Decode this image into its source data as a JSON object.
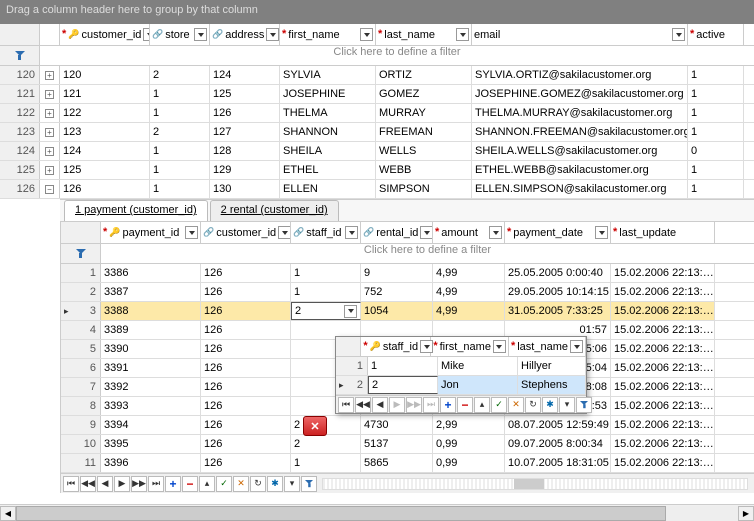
{
  "group_hint": "Drag a column header here to group by that column",
  "filter_hint": "Click here to define a filter",
  "main_columns": {
    "customer_id": "customer_id",
    "store": "store",
    "address": "address",
    "first_name": "first_name",
    "last_name": "last_name",
    "email": "email",
    "active": "active"
  },
  "main_rows": [
    {
      "rn": "120",
      "cid": "120",
      "store": "2",
      "addr": "124",
      "fn": "SYLVIA",
      "ln": "ORTIZ",
      "email": "SYLVIA.ORTIZ@sakilacustomer.org",
      "act": "1",
      "exp": "plus"
    },
    {
      "rn": "121",
      "cid": "121",
      "store": "1",
      "addr": "125",
      "fn": "JOSEPHINE",
      "ln": "GOMEZ",
      "email": "JOSEPHINE.GOMEZ@sakilacustomer.org",
      "act": "1",
      "exp": "plus"
    },
    {
      "rn": "122",
      "cid": "122",
      "store": "1",
      "addr": "126",
      "fn": "THELMA",
      "ln": "MURRAY",
      "email": "THELMA.MURRAY@sakilacustomer.org",
      "act": "1",
      "exp": "plus"
    },
    {
      "rn": "123",
      "cid": "123",
      "store": "2",
      "addr": "127",
      "fn": "SHANNON",
      "ln": "FREEMAN",
      "email": "SHANNON.FREEMAN@sakilacustomer.org",
      "act": "1",
      "exp": "plus"
    },
    {
      "rn": "124",
      "cid": "124",
      "store": "1",
      "addr": "128",
      "fn": "SHEILA",
      "ln": "WELLS",
      "email": "SHEILA.WELLS@sakilacustomer.org",
      "act": "0",
      "exp": "plus"
    },
    {
      "rn": "125",
      "cid": "125",
      "store": "1",
      "addr": "129",
      "fn": "ETHEL",
      "ln": "WEBB",
      "email": "ETHEL.WEBB@sakilacustomer.org",
      "act": "1",
      "exp": "plus"
    },
    {
      "rn": "126",
      "cid": "126",
      "store": "1",
      "addr": "130",
      "fn": "ELLEN",
      "ln": "SIMPSON",
      "email": "ELLEN.SIMPSON@sakilacustomer.org",
      "act": "1",
      "exp": "minus"
    }
  ],
  "tabs": {
    "payment": "1 payment (customer_id)",
    "rental": "2 rental (customer_id)"
  },
  "sub_columns": {
    "payment_id": "payment_id",
    "customer_id": "customer_id",
    "staff_id": "staff_id",
    "rental_id": "rental_id",
    "amount": "amount",
    "payment_date": "payment_date",
    "last_update": "last_update"
  },
  "sub_rows": [
    {
      "rn": "1",
      "pid": "3386",
      "cid": "126",
      "sid": "1",
      "rid": "9",
      "amt": "4,99",
      "pdate": "25.05.2005 0:00:40",
      "lup": "15.02.2006 22:13:…"
    },
    {
      "rn": "2",
      "pid": "3387",
      "cid": "126",
      "sid": "1",
      "rid": "752",
      "amt": "4,99",
      "pdate": "29.05.2005 10:14:15",
      "lup": "15.02.2006 22:13:…"
    },
    {
      "rn": "3",
      "pid": "3388",
      "cid": "126",
      "sid": "2",
      "rid": "1054",
      "amt": "4,99",
      "pdate": "31.05.2005 7:33:25",
      "lup": "15.02.2006 22:13:…"
    },
    {
      "rn": "4",
      "pid": "3389",
      "cid": "126",
      "sid": "",
      "rid": "",
      "amt": "",
      "pdate": "01:57",
      "lup": "15.02.2006 22:13:…"
    },
    {
      "rn": "5",
      "pid": "3390",
      "cid": "126",
      "sid": "",
      "rid": "",
      "amt": "",
      "pdate": "15:06",
      "lup": "15.02.2006 22:13:…"
    },
    {
      "rn": "6",
      "pid": "3391",
      "cid": "126",
      "sid": "",
      "rid": "",
      "amt": "",
      "pdate": "15:04",
      "lup": "15.02.2006 22:13:…"
    },
    {
      "rn": "7",
      "pid": "3392",
      "cid": "126",
      "sid": "",
      "rid": "",
      "amt": "",
      "pdate": "08:08",
      "lup": "15.02.2006 22:13:…"
    },
    {
      "rn": "8",
      "pid": "3393",
      "cid": "126",
      "sid": "",
      "rid": "",
      "amt": "",
      "pdate": "04:53",
      "lup": "15.02.2006 22:13:…"
    },
    {
      "rn": "9",
      "pid": "3394",
      "cid": "126",
      "sid": "2",
      "rid": "4730",
      "amt": "2,99",
      "pdate": "08.07.2005 12:59:49",
      "lup": "15.02.2006 22:13:…"
    },
    {
      "rn": "10",
      "pid": "3395",
      "cid": "126",
      "sid": "2",
      "rid": "5137",
      "amt": "0,99",
      "pdate": "09.07.2005 8:00:34",
      "lup": "15.02.2006 22:13:…"
    },
    {
      "rn": "11",
      "pid": "3396",
      "cid": "126",
      "sid": "1",
      "rid": "5865",
      "amt": "0,99",
      "pdate": "10.07.2005 18:31:05",
      "lup": "15.02.2006 22:13:…"
    }
  ],
  "popup_columns": {
    "staff_id": "staff_id",
    "first_name": "first_name",
    "last_name": "last_name"
  },
  "popup_rows": [
    {
      "rn": "1",
      "sid": "1",
      "fn": "Mike",
      "ln": "Hillyer"
    },
    {
      "rn": "2",
      "sid": "2",
      "fn": "Jon",
      "ln": "Stephens"
    }
  ]
}
